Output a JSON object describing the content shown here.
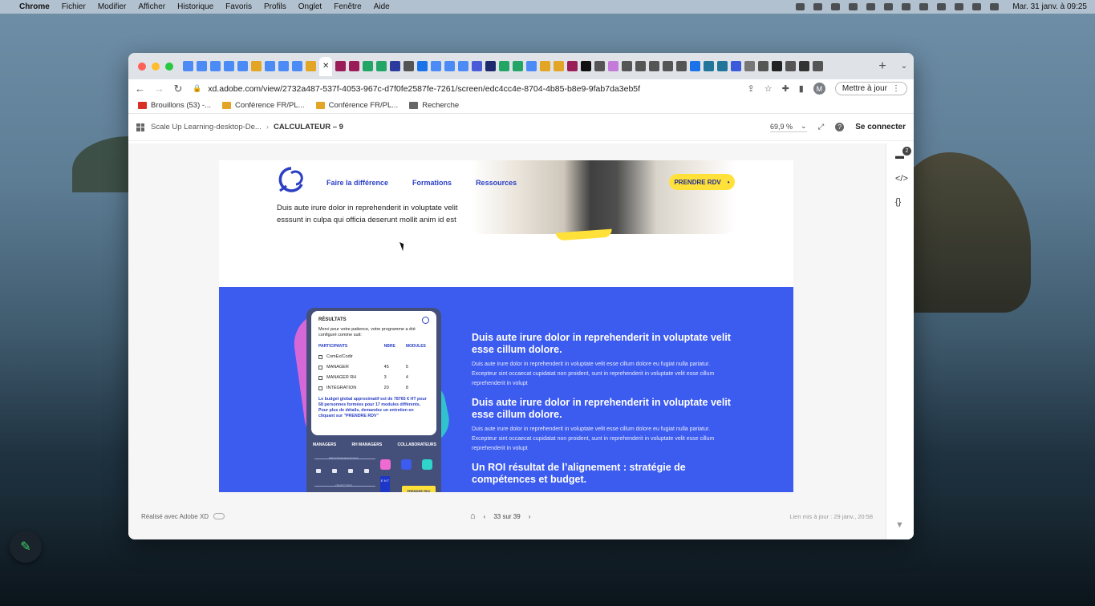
{
  "menubar": {
    "app": "Chrome",
    "items": [
      "Fichier",
      "Modifier",
      "Afficher",
      "Historique",
      "Favoris",
      "Profils",
      "Onglet",
      "Fenêtre",
      "Aide"
    ],
    "clock": "Mar. 31 janv. à 09:25"
  },
  "browser": {
    "url": "xd.adobe.com/view/2732a487-537f-4053-967c-d7f0fe2587fe-7261/screen/edc4cc4e-8704-4b85-b8e9-9fab7da3eb5f",
    "avatar_letter": "M",
    "update_label": "Mettre à jour",
    "tab_colors": [
      "#4c8bf5",
      "#4c8bf5",
      "#4c8bf5",
      "#4c8bf5",
      "#4c8bf5",
      "#e2a525",
      "#4c8bf5",
      "#4c8bf5",
      "#4c8bf5",
      "#e2a525",
      "#9b1d58",
      "#9b1d58",
      "#23a566",
      "#23a566",
      "#2b3c9e",
      "#555",
      "#1a73e8",
      "#4c8bf5",
      "#4c8bf5",
      "#4c8bf5",
      "#4a5bd8",
      "#1d2b6e",
      "#23a566",
      "#23a566",
      "#4c8bf5",
      "#e2a525",
      "#e2a525",
      "#9b1d58",
      "#111",
      "#555",
      "#c47ad8",
      "#555",
      "#555",
      "#555",
      "#555",
      "#555",
      "#1a73e8",
      "#21759b",
      "#21759b",
      "#3b5bdb",
      "#777",
      "#555",
      "#222",
      "#555",
      "#333",
      "#555"
    ],
    "bookmarks": [
      {
        "label": "Brouillons (53) -...",
        "color": "#d93025"
      },
      {
        "label": "Conférence FR/PL...",
        "color": "#e2a525"
      },
      {
        "label": "Conférence FR/PL...",
        "color": "#e2a525"
      },
      {
        "label": "Recherche",
        "color": "#666"
      }
    ]
  },
  "xd": {
    "breadcrumb_project": "Scale Up Learning-desktop-De...",
    "breadcrumb_screen": "CALCULATEUR – 9",
    "zoom": "69,9 %",
    "connect": "Se connecter",
    "comment_count": "2",
    "footer_made": "Réalisé avec Adobe XD",
    "page_indicator": "33 sur 39",
    "updated": "Lien mis à jour : 29 janv., 20:58"
  },
  "artboard": {
    "nav": [
      "Faire la différence",
      "Formations",
      "Ressources"
    ],
    "cta": "PRENDRE RDV",
    "cta_dot": "•",
    "intro": "Duis aute irure dolor in reprehenderit in voluptate velit esssunt in culpa qui officia deserunt mollit anim id est",
    "phone": {
      "title": "RÉSULTATS",
      "intro": "Merci pour votre patience, votre programme a été configuré comme suit:",
      "col_participants": "PARTICIPANTS",
      "col_nbre": "NBRE",
      "col_modules": "MODULES",
      "rows": [
        {
          "label": "ComEx/Codir",
          "nbre": "",
          "modules": ""
        },
        {
          "label": "MANAGER",
          "nbre": "45",
          "modules": "5"
        },
        {
          "label": "MANAGER RH",
          "nbre": "3",
          "modules": "4"
        },
        {
          "label": "INTÉGRATION",
          "nbre": "20",
          "modules": "8"
        }
      ],
      "budget": "Le budget global approximatif est de 78765 € HT pour 68 personnes formées pour 17 modules différents. Pour plus de détails, demandez un entretien en cliquant sur \"PRENDRE RDV\"",
      "tabs": [
        "MANAGERS",
        "RH MANAGERS",
        "COLLABORATEURS"
      ],
      "label_a": "PROGRAMMATIONS",
      "label_b": "OBJECTIFS",
      "bar_text": "E N T",
      "cta": "PRENDRE RDV"
    },
    "blocks": [
      {
        "heading": "Duis aute irure dolor in reprehenderit in voluptate velit esse cillum dolore.",
        "body": "Duis aute irure dolor in reprehenderit in voluptate velit esse cillum dolore eu fugiat nulla pariatur. Excepteur sint occaecat cupidatat non proident, sunt in reprehenderit in voluptate velit esse cillum reprehenderit in volupt"
      },
      {
        "heading": "Duis aute irure dolor in reprehenderit in voluptate velit esse cillum dolore.",
        "body": "Duis aute irure dolor in reprehenderit in voluptate velit esse cillum dolore eu fugiat nulla pariatur. Excepteur sint occaecat cupidatat non proident, sunt in reprehenderit in voluptate velit esse cillum reprehenderit in volupt"
      },
      {
        "heading": "Un ROI résultat de l’alignement : stratégie de compétences et budget.",
        "body": ""
      }
    ]
  }
}
